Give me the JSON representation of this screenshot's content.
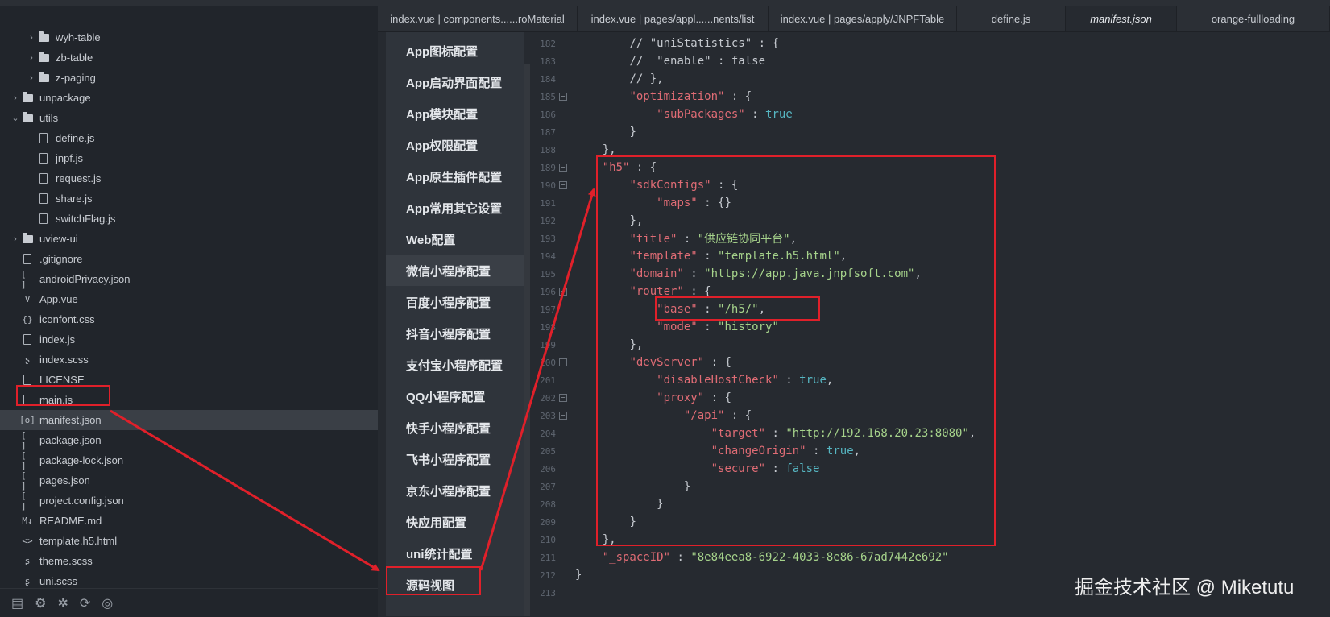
{
  "explorer": {
    "items": [
      {
        "label": "wyh-table",
        "type": "folder",
        "level": 2,
        "expanded": false
      },
      {
        "label": "zb-table",
        "type": "folder",
        "level": 2,
        "expanded": false
      },
      {
        "label": "z-paging",
        "type": "folder",
        "level": 2,
        "expanded": false
      },
      {
        "label": "unpackage",
        "type": "folder",
        "level": 1,
        "expanded": false
      },
      {
        "label": "utils",
        "type": "folder",
        "level": 1,
        "expanded": true
      },
      {
        "label": "define.js",
        "type": "file",
        "icon": "js",
        "level": 2
      },
      {
        "label": "jnpf.js",
        "type": "file",
        "icon": "js",
        "level": 2
      },
      {
        "label": "request.js",
        "type": "file",
        "icon": "js",
        "level": 2
      },
      {
        "label": "share.js",
        "type": "file",
        "icon": "js",
        "level": 2
      },
      {
        "label": "switchFlag.js",
        "type": "file",
        "icon": "js",
        "level": 2
      },
      {
        "label": "uview-ui",
        "type": "folder",
        "level": 1,
        "expanded": false
      },
      {
        "label": ".gitignore",
        "type": "file",
        "icon": "file",
        "level": 1
      },
      {
        "label": "androidPrivacy.json",
        "type": "file",
        "icon": "[ ]",
        "level": 1
      },
      {
        "label": "App.vue",
        "type": "file",
        "icon": "V",
        "level": 1
      },
      {
        "label": "iconfont.css",
        "type": "file",
        "icon": "{}",
        "level": 1
      },
      {
        "label": "index.js",
        "type": "file",
        "icon": "js",
        "level": 1
      },
      {
        "label": "index.scss",
        "type": "file",
        "icon": "scss",
        "level": 1
      },
      {
        "label": "LICENSE",
        "type": "file",
        "icon": "file",
        "level": 1
      },
      {
        "label": "main.js",
        "type": "file",
        "icon": "js",
        "level": 1
      },
      {
        "label": "manifest.json",
        "type": "file",
        "icon": "[o]",
        "level": 1,
        "selected": true
      },
      {
        "label": "package.json",
        "type": "file",
        "icon": "[ ]",
        "level": 1
      },
      {
        "label": "package-lock.json",
        "type": "file",
        "icon": "[ ]",
        "level": 1
      },
      {
        "label": "pages.json",
        "type": "file",
        "icon": "[ ]",
        "level": 1
      },
      {
        "label": "project.config.json",
        "type": "file",
        "icon": "[ ]",
        "level": 1
      },
      {
        "label": "README.md",
        "type": "file",
        "icon": "M↓",
        "level": 1
      },
      {
        "label": "template.h5.html",
        "type": "file",
        "icon": "<>",
        "level": 1
      },
      {
        "label": "theme.scss",
        "type": "file",
        "icon": "scss",
        "level": 1
      },
      {
        "label": "uni.scss",
        "type": "file",
        "icon": "scss",
        "level": 1
      }
    ]
  },
  "tabs": [
    {
      "label": "index.vue | components......roMaterial",
      "active": false
    },
    {
      "label": "index.vue | pages/appl......nents/list",
      "active": false
    },
    {
      "label": "index.vue | pages/apply/JNPFTable",
      "active": false
    },
    {
      "label": "define.js",
      "active": false
    },
    {
      "label": "manifest.json",
      "active": true
    },
    {
      "label": "orange-fullloading",
      "active": false
    }
  ],
  "config_nav": [
    {
      "label": "App图标配置"
    },
    {
      "label": "App启动界面配置"
    },
    {
      "label": "App模块配置"
    },
    {
      "label": "App权限配置"
    },
    {
      "label": "App原生插件配置"
    },
    {
      "label": "App常用其它设置"
    },
    {
      "label": "Web配置"
    },
    {
      "label": "微信小程序配置",
      "active": true
    },
    {
      "label": "百度小程序配置"
    },
    {
      "label": "抖音小程序配置"
    },
    {
      "label": "支付宝小程序配置"
    },
    {
      "label": "QQ小程序配置"
    },
    {
      "label": "快手小程序配置"
    },
    {
      "label": "飞书小程序配置"
    },
    {
      "label": "京东小程序配置"
    },
    {
      "label": "快应用配置"
    },
    {
      "label": "uni统计配置"
    },
    {
      "label": "源码视图",
      "boxed": true
    }
  ],
  "code": [
    {
      "n": "182",
      "fold": false,
      "indent": 2,
      "tokens": [
        [
          "cmt",
          "// \"uniStatistics\" : {"
        ]
      ]
    },
    {
      "n": "183",
      "fold": false,
      "indent": 2,
      "tokens": [
        [
          "cmt",
          "//  \"enable\" : false"
        ]
      ]
    },
    {
      "n": "184",
      "fold": false,
      "indent": 2,
      "tokens": [
        [
          "cmt",
          "// },"
        ]
      ]
    },
    {
      "n": "185",
      "fold": true,
      "indent": 2,
      "tokens": [
        [
          "str",
          "\"optimization\""
        ],
        [
          "p",
          " : {"
        ]
      ]
    },
    {
      "n": "186",
      "fold": false,
      "indent": 3,
      "tokens": [
        [
          "str",
          "\"subPackages\""
        ],
        [
          "p",
          " : "
        ],
        [
          "bool",
          "true"
        ]
      ]
    },
    {
      "n": "187",
      "fold": false,
      "indent": 2,
      "tokens": [
        [
          "p",
          "}"
        ]
      ]
    },
    {
      "n": "188",
      "fold": false,
      "indent": 1,
      "tokens": [
        [
          "p",
          "},"
        ]
      ]
    },
    {
      "n": "189",
      "fold": true,
      "indent": 1,
      "tokens": [
        [
          "str",
          "\"h5\""
        ],
        [
          "p",
          " : {"
        ]
      ]
    },
    {
      "n": "190",
      "fold": true,
      "indent": 2,
      "tokens": [
        [
          "str",
          "\"sdkConfigs\""
        ],
        [
          "p",
          " : {"
        ]
      ]
    },
    {
      "n": "191",
      "fold": false,
      "indent": 3,
      "tokens": [
        [
          "str",
          "\"maps\""
        ],
        [
          "p",
          " : {}"
        ]
      ]
    },
    {
      "n": "192",
      "fold": false,
      "indent": 2,
      "tokens": [
        [
          "p",
          "},"
        ]
      ]
    },
    {
      "n": "193",
      "fold": false,
      "indent": 2,
      "tokens": [
        [
          "str",
          "\"title\""
        ],
        [
          "p",
          " : "
        ],
        [
          "val",
          "\"供应链协同平台\""
        ],
        [
          "p",
          ","
        ]
      ]
    },
    {
      "n": "194",
      "fold": false,
      "indent": 2,
      "tokens": [
        [
          "str",
          "\"template\""
        ],
        [
          "p",
          " : "
        ],
        [
          "val",
          "\"template.h5.html\""
        ],
        [
          "p",
          ","
        ]
      ]
    },
    {
      "n": "195",
      "fold": false,
      "indent": 2,
      "tokens": [
        [
          "str",
          "\"domain\""
        ],
        [
          "p",
          " : "
        ],
        [
          "val",
          "\"https://app.java.jnpfsoft.com\""
        ],
        [
          "p",
          ","
        ]
      ]
    },
    {
      "n": "196",
      "fold": true,
      "indent": 2,
      "tokens": [
        [
          "str",
          "\"router\""
        ],
        [
          "p",
          " : {"
        ]
      ]
    },
    {
      "n": "197",
      "fold": false,
      "indent": 3,
      "tokens": [
        [
          "str",
          "\"base\""
        ],
        [
          "p",
          " : "
        ],
        [
          "val",
          "\"/h5/\""
        ],
        [
          "p",
          ","
        ]
      ]
    },
    {
      "n": "198",
      "fold": false,
      "indent": 3,
      "tokens": [
        [
          "str",
          "\"mode\""
        ],
        [
          "p",
          " : "
        ],
        [
          "val",
          "\"history\""
        ]
      ]
    },
    {
      "n": "199",
      "fold": false,
      "indent": 2,
      "tokens": [
        [
          "p",
          "},"
        ]
      ]
    },
    {
      "n": "200",
      "fold": true,
      "indent": 2,
      "tokens": [
        [
          "str",
          "\"devServer\""
        ],
        [
          "p",
          " : {"
        ]
      ]
    },
    {
      "n": "201",
      "fold": false,
      "indent": 3,
      "tokens": [
        [
          "str",
          "\"disableHostCheck\""
        ],
        [
          "p",
          " : "
        ],
        [
          "bool",
          "true"
        ],
        [
          "p",
          ","
        ]
      ]
    },
    {
      "n": "202",
      "fold": true,
      "indent": 3,
      "tokens": [
        [
          "str",
          "\"proxy\""
        ],
        [
          "p",
          " : {"
        ]
      ]
    },
    {
      "n": "203",
      "fold": true,
      "indent": 4,
      "tokens": [
        [
          "str",
          "\"/api\""
        ],
        [
          "p",
          " : {"
        ]
      ]
    },
    {
      "n": "204",
      "fold": false,
      "indent": 5,
      "tokens": [
        [
          "str",
          "\"target\""
        ],
        [
          "p",
          " : "
        ],
        [
          "val",
          "\"http://192.168.20.23:8080\""
        ],
        [
          "p",
          ","
        ]
      ]
    },
    {
      "n": "205",
      "fold": false,
      "indent": 5,
      "tokens": [
        [
          "str",
          "\"changeOrigin\""
        ],
        [
          "p",
          " : "
        ],
        [
          "bool",
          "true"
        ],
        [
          "p",
          ","
        ]
      ]
    },
    {
      "n": "206",
      "fold": false,
      "indent": 5,
      "tokens": [
        [
          "str",
          "\"secure\""
        ],
        [
          "p",
          " : "
        ],
        [
          "bool",
          "false"
        ]
      ]
    },
    {
      "n": "207",
      "fold": false,
      "indent": 4,
      "tokens": [
        [
          "p",
          "}"
        ]
      ]
    },
    {
      "n": "208",
      "fold": false,
      "indent": 3,
      "tokens": [
        [
          "p",
          "}"
        ]
      ]
    },
    {
      "n": "209",
      "fold": false,
      "indent": 2,
      "tokens": [
        [
          "p",
          "}"
        ]
      ]
    },
    {
      "n": "210",
      "fold": false,
      "indent": 1,
      "tokens": [
        [
          "p",
          "},"
        ]
      ]
    },
    {
      "n": "211",
      "fold": false,
      "indent": 1,
      "tokens": [
        [
          "str",
          "\"_spaceID\""
        ],
        [
          "p",
          " : "
        ],
        [
          "val",
          "\"8e84eea8-6922-4033-8e86-67ad7442e692\""
        ]
      ]
    },
    {
      "n": "212",
      "fold": false,
      "indent": 0,
      "tokens": [
        [
          "p",
          "}"
        ]
      ]
    },
    {
      "n": "213",
      "fold": false,
      "indent": 0,
      "tokens": []
    }
  ],
  "watermark": "掘金技术社区 @ Miketutu",
  "colors": {
    "annotation": "#e0202a",
    "string_key": "#e06c75",
    "string_val": "#a6d38b",
    "boolean": "#56b6c2"
  }
}
